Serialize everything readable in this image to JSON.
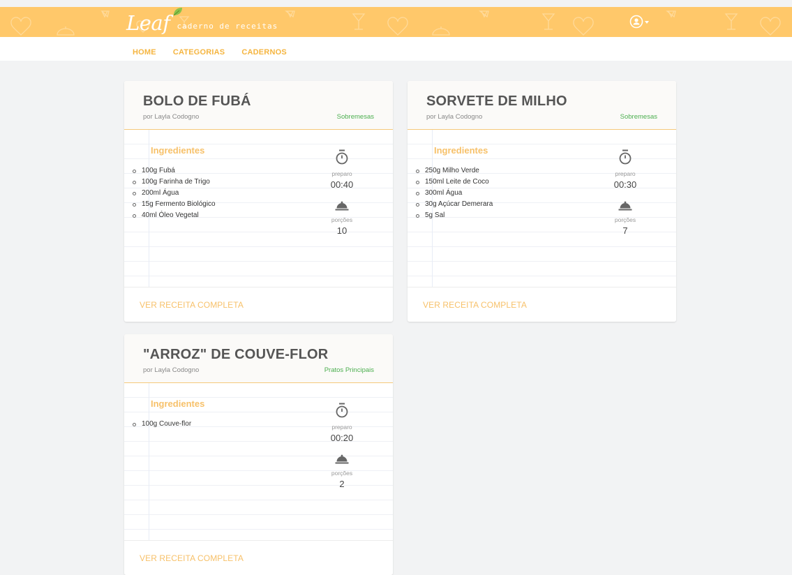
{
  "app": {
    "logo_text": "Leaf",
    "tagline": "caderno de receitas"
  },
  "nav": {
    "items": [
      {
        "label": "HOME"
      },
      {
        "label": "CATEGORIAS"
      },
      {
        "label": "CADERNOS"
      }
    ]
  },
  "colors": {
    "header": "#ffc86a",
    "accent": "#f5b540",
    "category": "#4caf50"
  },
  "recipes": [
    {
      "title": "BOLO DE FUBÁ",
      "author": "por Layla Codogno",
      "category": "Sobremesas",
      "ingredients_title": "Ingredientes",
      "ingredients": [
        "100g Fubá",
        "100g Farinha de Trigo",
        "200ml Água",
        "15g Fermento Biológico",
        "40ml Óleo Vegetal"
      ],
      "prep_label": "preparo",
      "prep_time": "00:40",
      "servings_label": "porções",
      "servings": "10",
      "link_label": "VER RECEITA COMPLETA"
    },
    {
      "title": "SORVETE DE MILHO",
      "author": "por Layla Codogno",
      "category": "Sobremesas",
      "ingredients_title": "Ingredientes",
      "ingredients": [
        "250g Milho Verde",
        "150ml Leite de Coco",
        "300ml Água",
        "30g Açúcar Demerara",
        "5g Sal"
      ],
      "prep_label": "preparo",
      "prep_time": "00:30",
      "servings_label": "porções",
      "servings": "7",
      "link_label": "VER RECEITA COMPLETA"
    },
    {
      "title": "\"ARROZ\" DE COUVE-FLOR",
      "author": "por Layla Codogno",
      "category": "Pratos Principais",
      "ingredients_title": "Ingredientes",
      "ingredients": [
        "100g Couve-flor"
      ],
      "prep_label": "preparo",
      "prep_time": "00:20",
      "servings_label": "porções",
      "servings": "2",
      "link_label": "VER RECEITA COMPLETA"
    }
  ]
}
